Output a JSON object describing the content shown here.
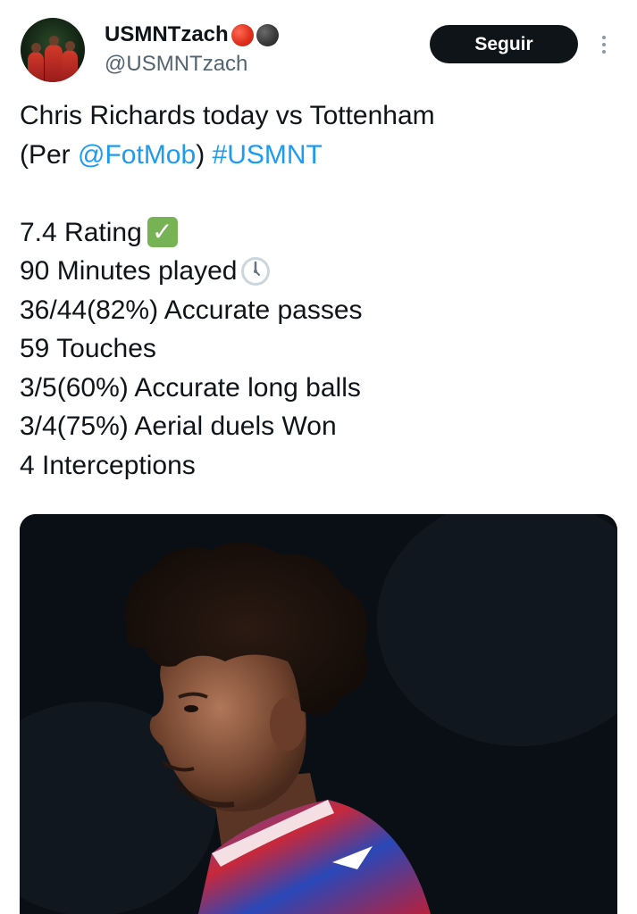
{
  "author": {
    "display_name": "USMNTzach",
    "handle": "@USMNTzach",
    "avatar_icon": "avatar-team-photo",
    "name_emojis": [
      "red-circle-icon",
      "black-circle-icon"
    ]
  },
  "follow_button": {
    "label": "Seguir"
  },
  "more_menu": {
    "icon": "more-vertical-icon"
  },
  "tweet": {
    "line1": "Chris Richards today vs Tottenham",
    "line2_prefix": "(Per ",
    "mention": "@FotMob",
    "line2_middle": ") ",
    "hashtag": "#USMNT",
    "stats": [
      {
        "text": "7.4 Rating",
        "emoji": "check-mark-icon"
      },
      {
        "text": "90 Minutes played",
        "emoji": "clock-icon"
      },
      {
        "text": "36/44(82%) Accurate passes"
      },
      {
        "text": "59 Touches"
      },
      {
        "text": "3/5(60%) Accurate long balls"
      },
      {
        "text": "3/4(75%) Aerial duels Won"
      },
      {
        "text": "4 Interceptions"
      }
    ]
  },
  "media": {
    "icon": "player-photo"
  },
  "colors": {
    "link": "#1d9bf0",
    "text": "#0f1419",
    "secondary": "#536471",
    "button_bg": "#0f1419",
    "button_text": "#ffffff"
  }
}
